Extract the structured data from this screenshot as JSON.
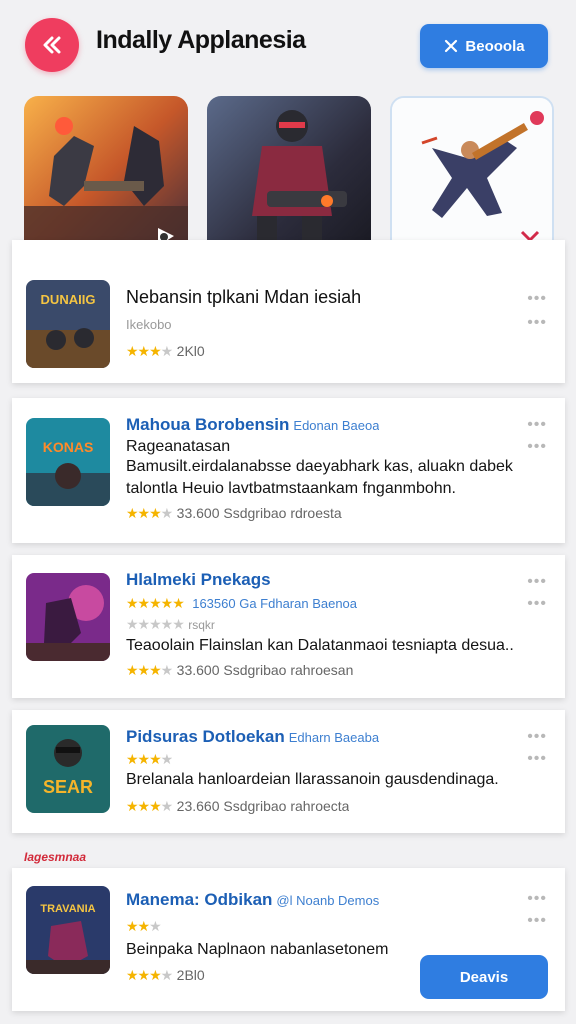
{
  "header": {
    "title": "Indally Applanesia",
    "action_label": "Beooola",
    "back_icon": "chevron-left-icon",
    "accent": "#ef3d5f",
    "button_color": "#2f7de1"
  },
  "featured": [
    {
      "name": "featured-game-1",
      "badge_icon": "brand-logo-icon"
    },
    {
      "name": "featured-game-2"
    },
    {
      "name": "featured-game-3",
      "badge_icon": "x-logo-icon"
    }
  ],
  "cards": [
    {
      "thumb_text": "DUNAIIG",
      "title": "Nebansin tplkani Mdan iesiah",
      "line2": "Ikekobo",
      "stars": 3,
      "meta": "2Kl0"
    },
    {
      "thumb_text": "KONAS",
      "title": "Mahoua Borobensin",
      "subtitle": "Edonan Baeoa",
      "line2": "Rageanatasan",
      "body1": "Bamusilt.eirdalanabsse daeyabhark kas, aluakn dabek",
      "body2": "talontla Heuio lavtbatmstaankam fnganmbohn.",
      "stars": 3,
      "meta": "33.600  Ssdgribao rdroesta"
    },
    {
      "title": "Hlalmeki Pnekags",
      "stars": 5,
      "meta_top": "163560  Ga Fdharan Baenoa",
      "line2": "rsqkr",
      "body1": "Teaoolain Flainslan kan Dalatanmaoi tesniapta desua..",
      "stars2": 3,
      "meta": "33.600  Ssdgribao rahroesan"
    },
    {
      "thumb_text": "SEAR",
      "title": "Pidsuras Dotloekan",
      "subtitle": "Edharn Baeaba",
      "stars": 3,
      "body1": "Brelanala hanloardeian llarassanoin gausdendinaga.",
      "stars2": 3,
      "meta": "23.660  Ssdgribao rahroecta"
    },
    {
      "thumb_text": "TRAVANIA",
      "title": "Manema: Odbikan",
      "subtitle": "@l Noanb Demos",
      "stars": 2,
      "body1": "Beinpaka Naplnaon nabanlasetonem",
      "stars2": 3,
      "meta": "2Bl0",
      "install_label": "Deavis"
    }
  ],
  "section_label": "Iagesmnaa"
}
